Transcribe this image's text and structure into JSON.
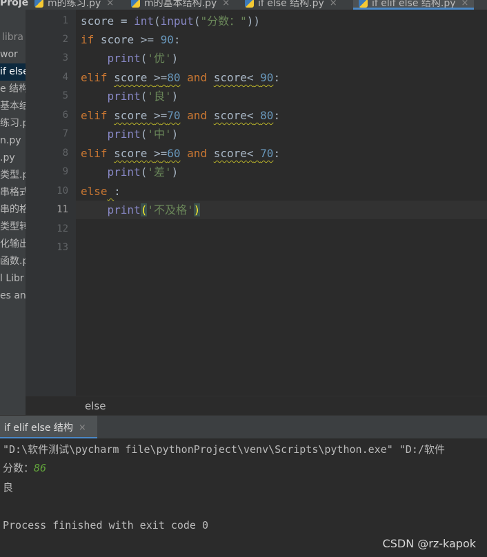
{
  "tabs": {
    "project_label": "Proje",
    "items": [
      {
        "label": "m的练习.py",
        "close": "×"
      },
      {
        "label": "m的基本结构.py",
        "close": "×"
      },
      {
        "label": "if else 结构.py",
        "close": "×"
      },
      {
        "label": "if elif else 结构.py",
        "close": "×",
        "active": true
      }
    ]
  },
  "project_panel": {
    "items": [
      "libra",
      "wor",
      "if else",
      "e 结构",
      "基本结",
      "练习.p",
      "n.py",
      ".py",
      "类型.p",
      "串格式",
      "串的格",
      "类型转",
      "化输出",
      "函数.p",
      "l Libr",
      "es an"
    ],
    "selected_index": 2
  },
  "editor": {
    "line_numbers": [
      "1",
      "2",
      "3",
      "4",
      "5",
      "6",
      "7",
      "8",
      "9",
      "10",
      "11",
      "12",
      "13"
    ],
    "current_line": 11,
    "lines": [
      "score = int(input(\"分数：\"))",
      "if score >= 90:",
      "    print('优')",
      "elif score >=80 and score< 90:",
      "    print('良')",
      "elif score >=70 and score< 80:",
      "    print('中')",
      "elif score >=60 and score< 70:",
      "    print('差')",
      "else :",
      "    print('不及格')",
      "",
      ""
    ]
  },
  "breadcrumb": {
    "text": "else"
  },
  "run_panel": {
    "tab_label": "if elif else 结构",
    "tab_close": "×",
    "console": {
      "command": "\"D:\\软件测试\\pycharm file\\pythonProject\\venv\\Scripts\\python.exe\" \"D:/软件",
      "prompt": "分数：",
      "input": "86",
      "output": "良",
      "blank": "",
      "exit": "Process finished with exit code 0"
    }
  },
  "watermark": "CSDN @rz-kapok",
  "colors": {
    "keyword": "#cc7832",
    "builtin": "#8888c6",
    "number": "#6897bb",
    "string": "#6a8759",
    "identifier": "#a9b7c6",
    "accent": "#4a88c7",
    "console_input": "#62a53b"
  }
}
